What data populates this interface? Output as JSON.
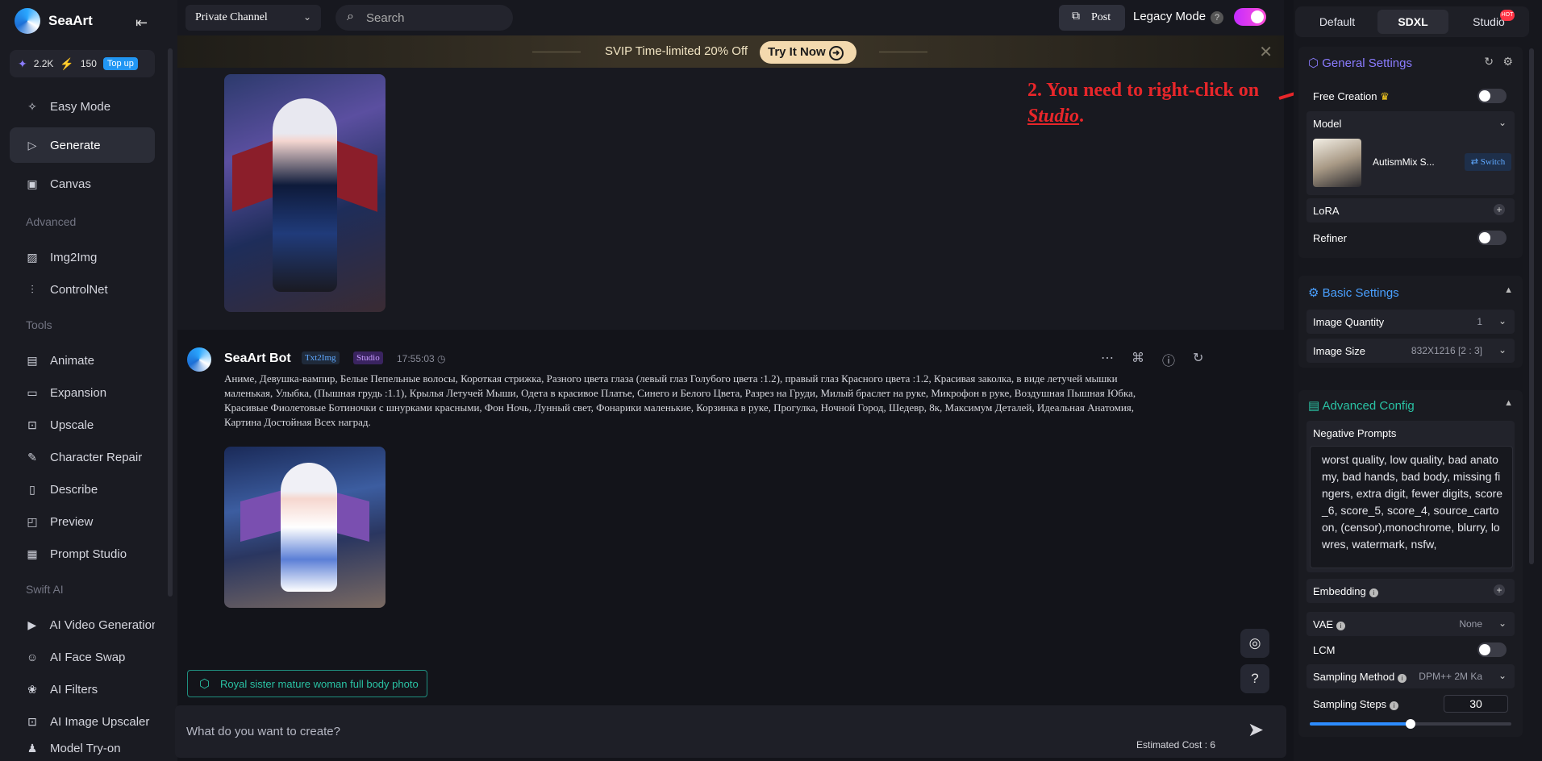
{
  "app": {
    "name": "SeaArt"
  },
  "sidebar": {
    "credit1": "2.2K",
    "credit2": "150",
    "topup": "Top up",
    "items": [
      {
        "label": "Easy Mode",
        "icon": "sparkle-icon"
      },
      {
        "label": "Generate",
        "icon": "play-icon",
        "active": true
      },
      {
        "label": "Canvas",
        "icon": "canvas-icon"
      }
    ],
    "section_advanced": "Advanced",
    "advanced": [
      {
        "label": "Img2Img",
        "icon": "image-icon"
      },
      {
        "label": "ControlNet",
        "icon": "sliders-icon"
      }
    ],
    "section_tools": "Tools",
    "tools": [
      {
        "label": "Animate",
        "icon": "film-icon"
      },
      {
        "label": "Expansion",
        "icon": "expand-icon"
      },
      {
        "label": "Upscale",
        "icon": "hd-icon"
      },
      {
        "label": "Character Repair",
        "icon": "brush-icon"
      },
      {
        "label": "Describe",
        "icon": "book-icon"
      },
      {
        "label": "Preview",
        "icon": "preview-icon"
      },
      {
        "label": "Prompt Studio",
        "icon": "grid-icon"
      }
    ],
    "section_swift": "Swift AI",
    "swift": [
      {
        "label": "AI Video Generation",
        "icon": "video-icon"
      },
      {
        "label": "AI Face Swap",
        "icon": "face-icon"
      },
      {
        "label": "AI Filters",
        "icon": "filter-icon"
      },
      {
        "label": "AI Image Upscaler",
        "icon": "hd-icon"
      },
      {
        "label": "Model Try-on",
        "icon": "shirt-icon"
      }
    ]
  },
  "topbar": {
    "channel": "Private Channel",
    "search_placeholder": "Search",
    "post": "Post",
    "legacy": "Legacy Mode"
  },
  "promo": {
    "text": "SVIP Time-limited 20% Off",
    "cta": "Try It Now"
  },
  "message": {
    "bot": "SeaArt Bot",
    "tag1": "Txt2Img",
    "tag2": "Studio",
    "time": "17:55:03",
    "prompt": "Аниме, Девушка-вампир, Белые Пепельные волосы, Короткая стрижка, Разного цвета глаза (левый глаз Голубого цвета :1.2), правый глаз Красного цвета :1.2, Красивая заколка, в виде летучей мышки маленькая, Улыбка, (Пышная грудь :1.1), Крылья Летучей Мыши, Одета в красивое Платье, Синего и Белого Цвета, Разрез на Груди, Милый браслет на руке, Микрофон в руке, Воздушная Пышная Юбка, Красивые Фиолетовые Ботиночки с шнурками красными, Фон Ночь, Лунный свет, Фонарики маленькие, Корзинка в руке, Прогулка, Ночной Город, Шедевр, 8к, Максимум Деталей, Идеальная Анатомия, Картина Достойная Всех наград."
  },
  "suggestion": "Royal sister mature woman full body photo",
  "input": {
    "placeholder": "What do you want to create?",
    "cost": "Estimated Cost : 6"
  },
  "annotation": {
    "line1": "2. You need to right-click on",
    "word": "Studio",
    "dot": "."
  },
  "right": {
    "tabs": [
      "Default",
      "SDXL",
      "Studio"
    ],
    "hot": "HOT",
    "general": "General Settings",
    "free_creation": "Free Creation",
    "model": "Model",
    "model_name": "AutismMix S...",
    "switch": "Switch",
    "lora": "LoRA",
    "refiner": "Refiner",
    "basic": "Basic Settings",
    "image_quantity": "Image Quantity",
    "image_quantity_val": "1",
    "image_size": "Image Size",
    "image_size_val": "832X1216  [2 : 3]",
    "advanced": "Advanced Config",
    "negative": "Negative Prompts",
    "negative_text": "worst quality, low quality, bad anatomy, bad hands, bad body, missing fingers, extra digit, fewer digits, score_6, score_5, score_4, source_cartoon, (censor),monochrome, blurry, lowres, watermark, nsfw,",
    "embedding": "Embedding",
    "vae": "VAE",
    "vae_val": "None",
    "lcm": "LCM",
    "sampling_method": "Sampling Method",
    "sampling_method_val": "DPM++ 2M Ka",
    "sampling_steps": "Sampling Steps",
    "sampling_steps_val": "30",
    "sampling_steps_fraction": 0.5
  },
  "colors": {
    "accent": "#2d8cff",
    "annotation": "#e8262a",
    "toggle": "#c42bff"
  }
}
